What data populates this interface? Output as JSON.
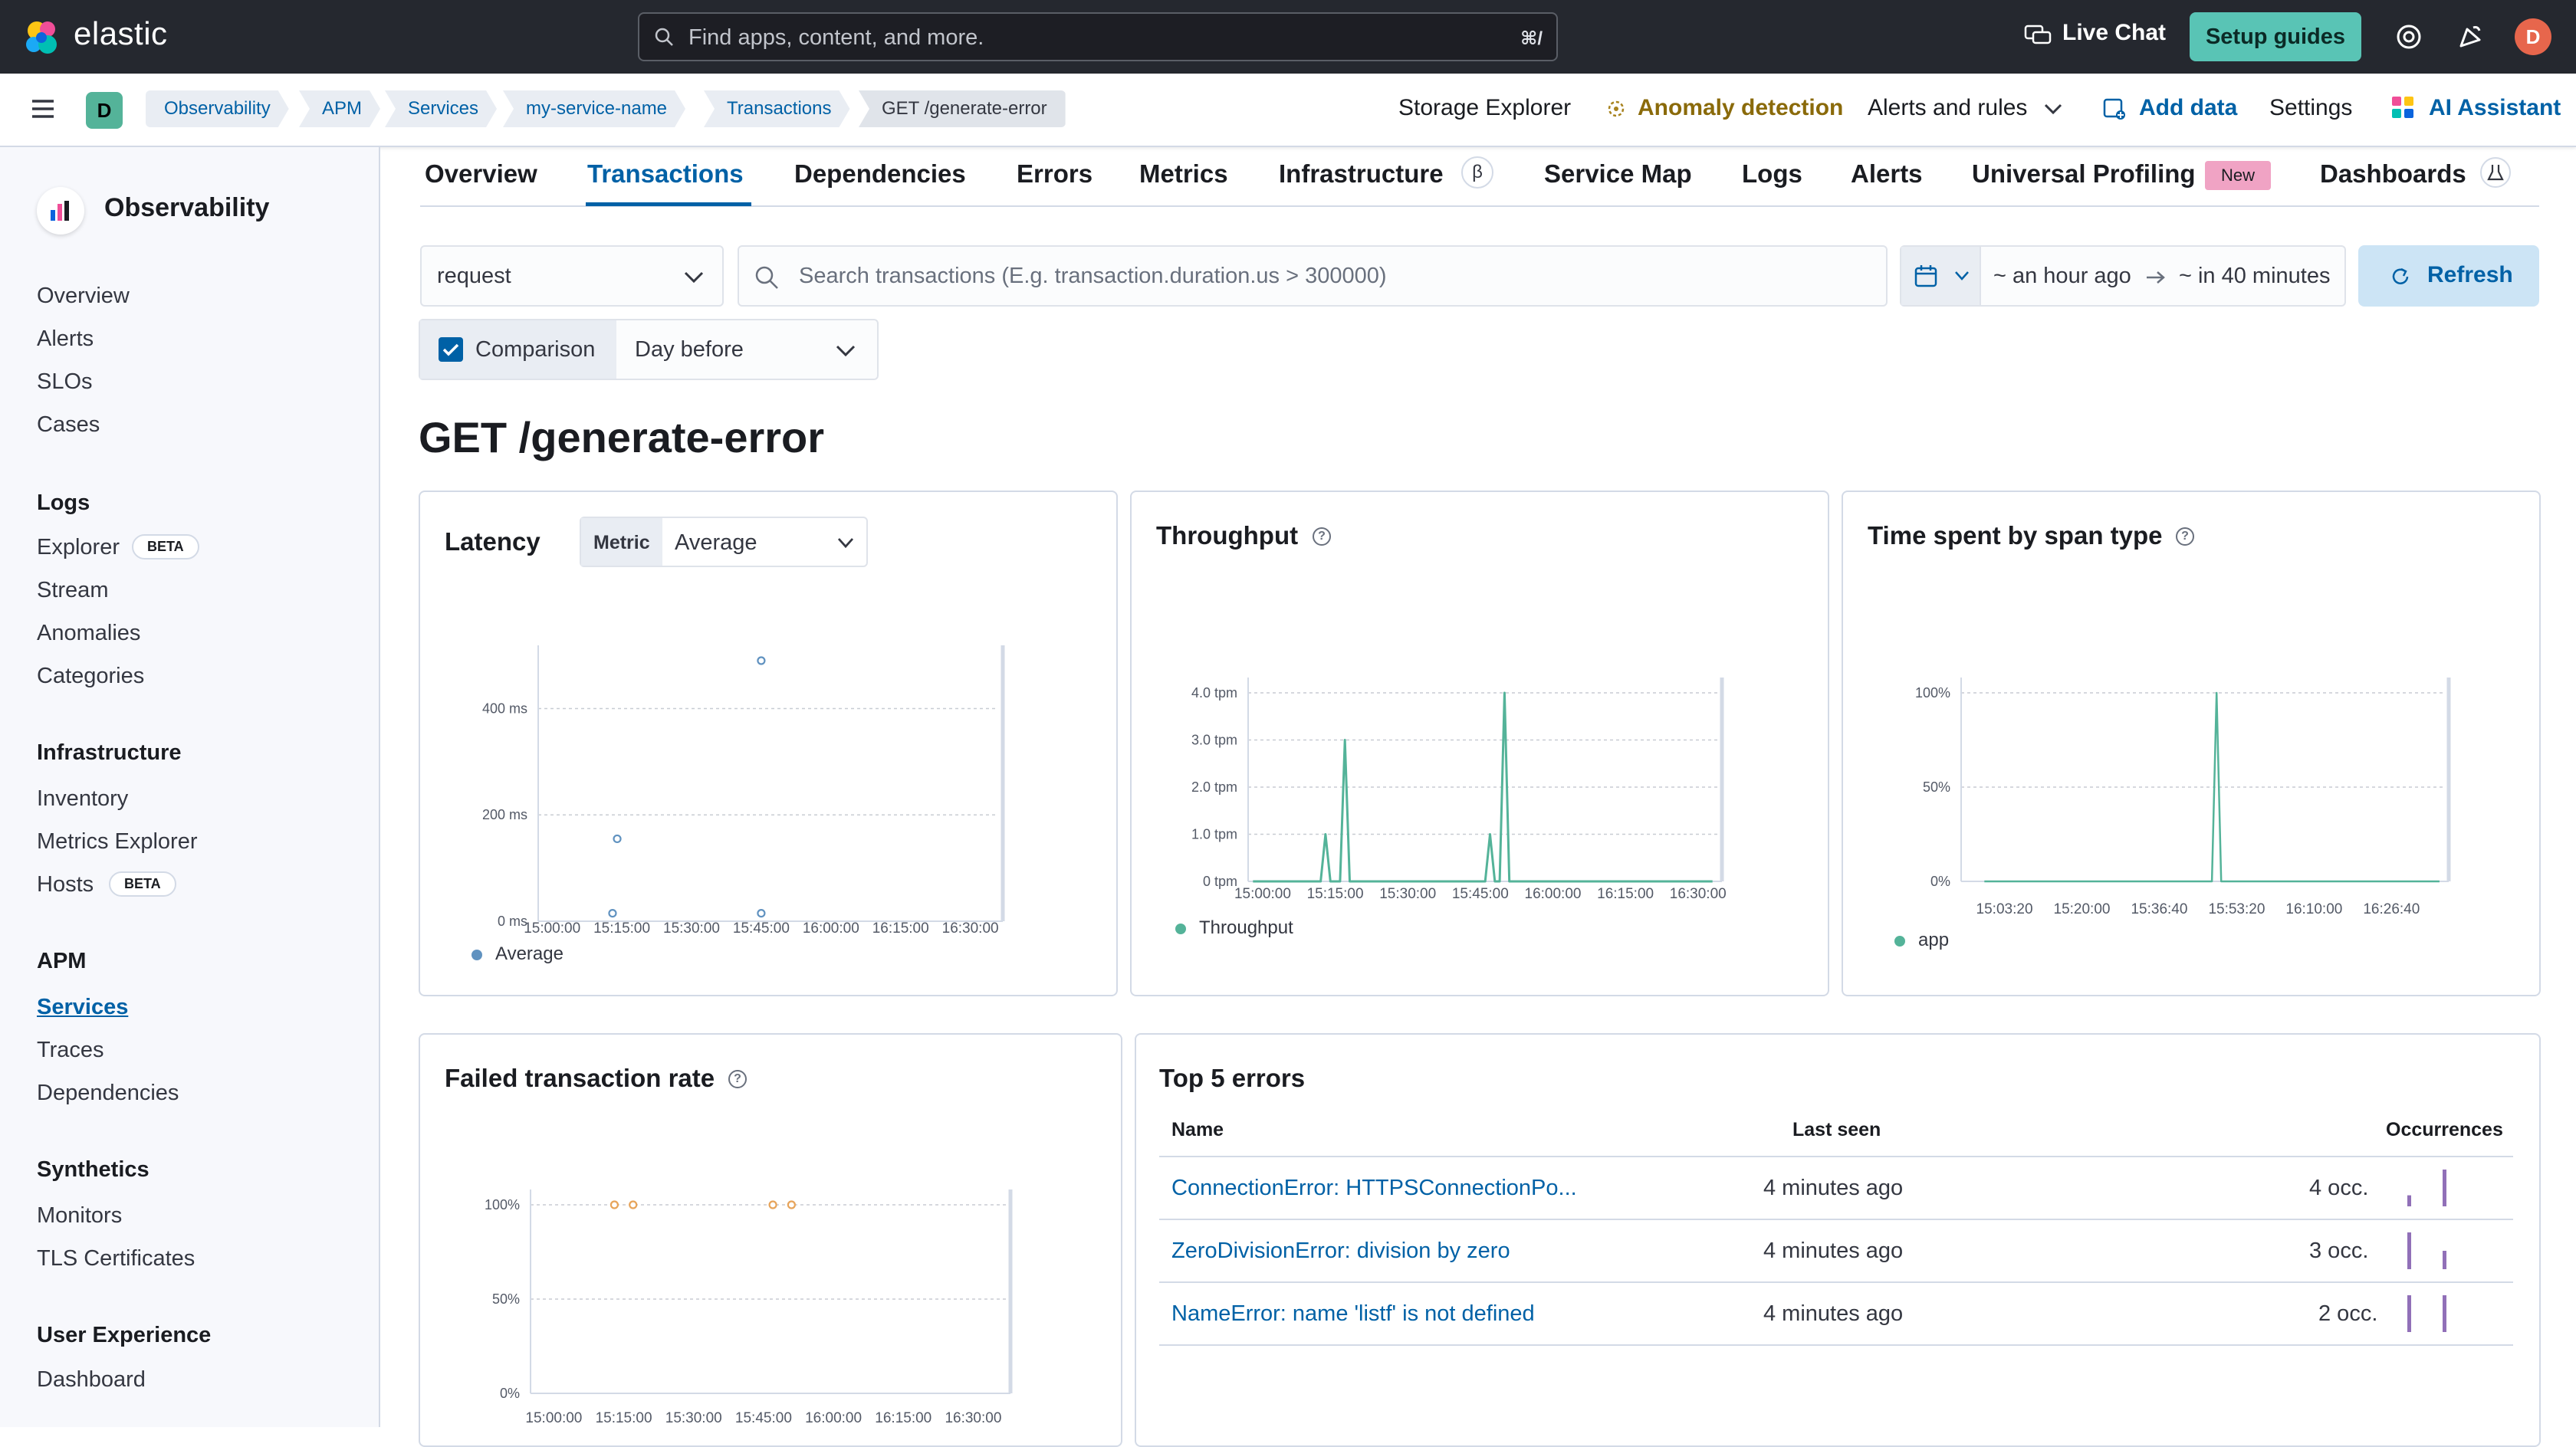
{
  "header": {
    "brand": "elastic",
    "search_placeholder": "Find apps, content, and more.",
    "search_shortcut": "⌘/",
    "live_chat": "Live Chat",
    "setup_guides": "Setup guides",
    "avatar_initial": "D"
  },
  "subbar": {
    "space_initial": "D",
    "breadcrumbs": [
      "Observability",
      "APM",
      "Services",
      "my-service-name",
      "Transactions",
      "GET /generate-error"
    ],
    "links": {
      "storage_explorer": "Storage Explorer",
      "anomaly_detection": "Anomaly detection",
      "alerts_and_rules": "Alerts and rules",
      "add_data": "Add data",
      "settings": "Settings",
      "ai_assistant": "AI Assistant"
    }
  },
  "sidebar": {
    "title": "Observability",
    "top_items": [
      "Overview",
      "Alerts",
      "SLOs",
      "Cases"
    ],
    "sections": [
      {
        "heading": "Logs",
        "items": [
          "Explorer",
          "Stream",
          "Anomalies",
          "Categories"
        ]
      },
      {
        "heading": "Infrastructure",
        "items": [
          "Inventory",
          "Metrics Explorer",
          "Hosts"
        ]
      },
      {
        "heading": "APM",
        "items": [
          "Services",
          "Traces",
          "Dependencies"
        ]
      },
      {
        "heading": "Synthetics",
        "items": [
          "Monitors",
          "TLS Certificates"
        ]
      },
      {
        "heading": "User Experience",
        "items": [
          "Dashboard"
        ]
      }
    ],
    "beta_label": "BETA",
    "active_item": "Services"
  },
  "tabs": {
    "items": [
      "Overview",
      "Transactions",
      "Dependencies",
      "Errors",
      "Metrics",
      "Infrastructure",
      "Service Map",
      "Logs",
      "Alerts",
      "Universal Profiling",
      "Dashboards"
    ],
    "active": "Transactions",
    "beta_symbol": "β",
    "new_badge": "New"
  },
  "filters": {
    "transaction_type": "request",
    "search_placeholder": "Search transactions (E.g. transaction.duration.us > 300000)",
    "time_start": "~ an hour ago",
    "time_end": "~ in 40 minutes",
    "refresh": "Refresh",
    "comparison_label": "Comparison",
    "comparison_checked": true,
    "comparison_value": "Day before"
  },
  "page_title": "GET /generate-error",
  "panels": {
    "latency": {
      "title": "Latency",
      "metric_label": "Metric",
      "metric_value": "Average"
    },
    "throughput": {
      "title": "Throughput"
    },
    "span_type": {
      "title": "Time spent by span type"
    },
    "failed_rate": {
      "title": "Failed transaction rate"
    },
    "top_errors": {
      "title": "Top 5 errors",
      "columns": [
        "Name",
        "Last seen",
        "Occurrences"
      ],
      "rows": [
        {
          "name": "ConnectionError: HTTPSConnectionPo...",
          "last_seen": "4 minutes ago",
          "occurrences": "4 occ.",
          "spark": [
            0.3,
            1.0
          ]
        },
        {
          "name": "ZeroDivisionError: division by zero",
          "last_seen": "4 minutes ago",
          "occurrences": "3 occ.",
          "spark": [
            1.0,
            0.5
          ]
        },
        {
          "name": "NameError: name 'listf' is not defined",
          "last_seen": "4 minutes ago",
          "occurrences": "2 occ.",
          "spark": [
            1.0,
            1.0
          ]
        }
      ]
    }
  },
  "chart_data": [
    {
      "type": "scatter",
      "title": "Latency",
      "x_ticks": [
        "15:00:00",
        "15:15:00",
        "15:30:00",
        "15:45:00",
        "16:00:00",
        "16:15:00",
        "16:30:00"
      ],
      "y_ticks": [
        "0 ms",
        "200 ms",
        "400 ms"
      ],
      "ylim": [
        0,
        490
      ],
      "series": [
        {
          "name": "Average",
          "color": "#6092c0",
          "points": [
            [
              "15:13:00",
              15
            ],
            [
              "15:14:00",
              155
            ],
            [
              "15:45:00",
              15
            ],
            [
              "15:45:00",
              490
            ]
          ]
        }
      ]
    },
    {
      "type": "line",
      "title": "Throughput",
      "x_ticks": [
        "15:00:00",
        "15:15:00",
        "15:30:00",
        "15:45:00",
        "16:00:00",
        "16:15:00",
        "16:30:00"
      ],
      "y_ticks": [
        "0 tpm",
        "1.0 tpm",
        "2.0 tpm",
        "3.0 tpm",
        "4.0 tpm"
      ],
      "ylim": [
        0,
        4
      ],
      "series": [
        {
          "name": "Throughput",
          "color": "#54b399",
          "points": [
            [
              "14:58:00",
              0
            ],
            [
              "15:12:00",
              0
            ],
            [
              "15:13:00",
              1
            ],
            [
              "15:14:00",
              0
            ],
            [
              "15:16:00",
              0
            ],
            [
              "15:17:00",
              3
            ],
            [
              "15:18:00",
              0
            ],
            [
              "15:46:00",
              0
            ],
            [
              "15:47:00",
              1
            ],
            [
              "15:48:00",
              0
            ],
            [
              "15:49:00",
              0
            ],
            [
              "15:50:00",
              4
            ],
            [
              "15:51:00",
              0
            ],
            [
              "16:33:00",
              0
            ]
          ]
        }
      ]
    },
    {
      "type": "area",
      "title": "Time spent by span type",
      "x_ticks": [
        "15:03:20",
        "15:20:00",
        "15:36:40",
        "15:53:20",
        "16:10:00",
        "16:26:40"
      ],
      "y_ticks": [
        "0%",
        "50%",
        "100%"
      ],
      "ylim": [
        0,
        100
      ],
      "series": [
        {
          "name": "app",
          "color": "#54b399",
          "points": [
            [
              "14:59:00",
              0
            ],
            [
              "15:48:00",
              0
            ],
            [
              "15:49:00",
              100
            ],
            [
              "15:50:00",
              0
            ],
            [
              "16:37:00",
              0
            ]
          ]
        }
      ]
    },
    {
      "type": "scatter",
      "title": "Failed transaction rate",
      "x_ticks": [
        "15:00:00",
        "15:15:00",
        "15:30:00",
        "15:45:00",
        "16:00:00",
        "16:15:00",
        "16:30:00"
      ],
      "y_ticks": [
        "0%",
        "50%",
        "100%"
      ],
      "ylim": [
        0,
        100
      ],
      "series": [
        {
          "name": "",
          "color": "#e7a45a",
          "points": [
            [
              "15:13:00",
              100
            ],
            [
              "15:17:00",
              100
            ],
            [
              "15:47:00",
              100
            ],
            [
              "15:51:00",
              100
            ]
          ]
        }
      ]
    }
  ]
}
